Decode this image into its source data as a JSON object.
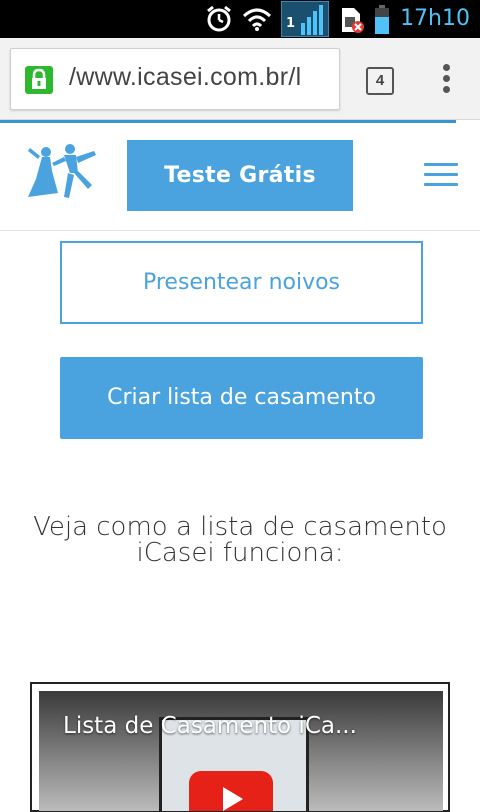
{
  "status_bar": {
    "time": "17h10",
    "signal_badge": "1",
    "icons": [
      "alarm-icon",
      "wifi-icon",
      "signal-icon",
      "sim-error-icon",
      "battery-icon"
    ]
  },
  "browser": {
    "url": "/www.icasei.com.br/l",
    "tab_count": "4"
  },
  "header": {
    "trial_button": "Teste Grátis"
  },
  "main": {
    "gift_button": "Presentear noivos",
    "create_list_button": "Criar lista de casamento",
    "headline_line1": "Veja como a lista de casamento",
    "headline_line2": "iCasei funciona:"
  },
  "video": {
    "title": "Lista de Casamento iCa..."
  },
  "colors": {
    "accent": "#4aa3df",
    "status_text": "#4fc3f7",
    "lock": "#2eb82e",
    "youtube_red": "#e62117"
  }
}
